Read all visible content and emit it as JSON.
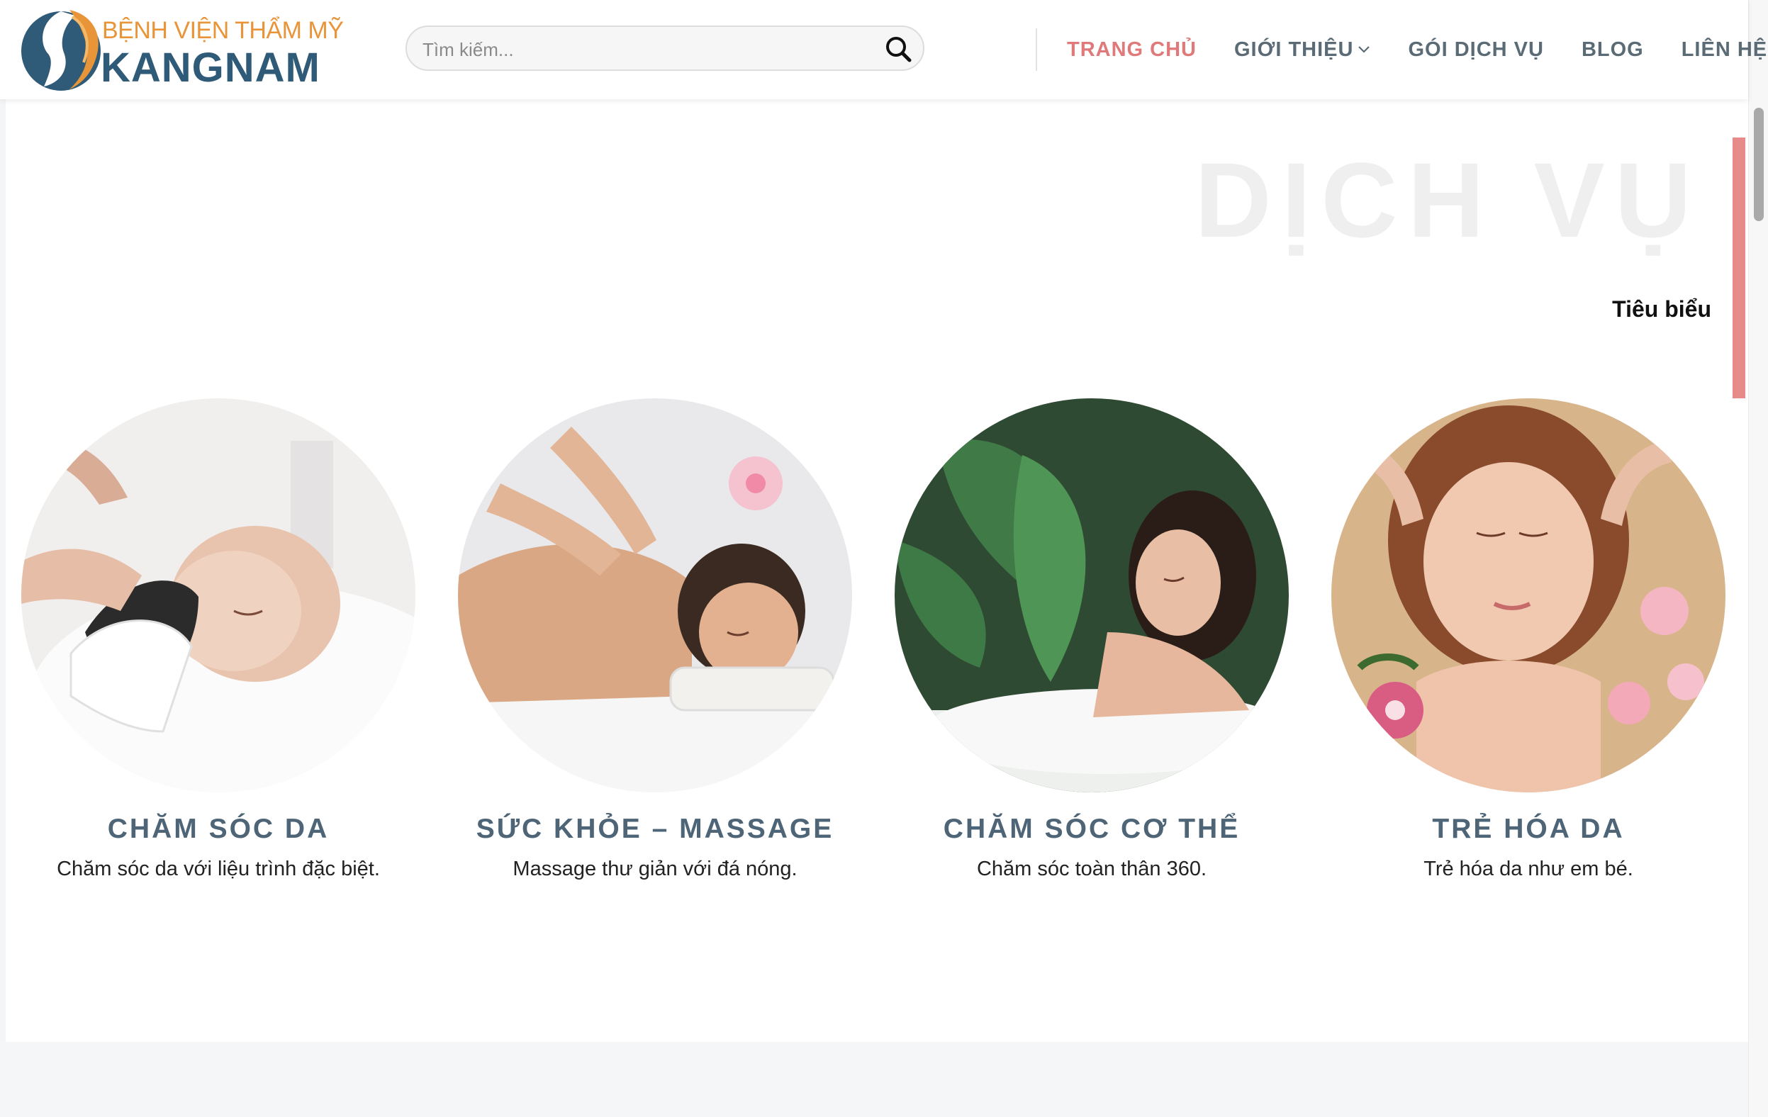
{
  "brand": {
    "line1": "BỆNH VIỆN THẨM MỸ",
    "line2": "KANGNAM",
    "colors": {
      "orange": "#e8953a",
      "navy": "#2f5a78"
    }
  },
  "search": {
    "placeholder": "Tìm kiếm..."
  },
  "nav": {
    "items": [
      {
        "label": "TRANG CHỦ",
        "active": true
      },
      {
        "label": "GIỚI THIỆU",
        "dropdown": true
      },
      {
        "label": "GÓI DỊCH VỤ"
      },
      {
        "label": "BLOG"
      },
      {
        "label": "LIÊN HỆ"
      }
    ],
    "active_color": "#e07a7a"
  },
  "section": {
    "title": "DỊCH VỤ",
    "subtitle": "Tiêu biểu"
  },
  "services": [
    {
      "title": "CHĂM SÓC DA",
      "desc": "Chăm sóc da với liệu trình đặc biệt."
    },
    {
      "title": "SỨC KHỎE – MASSAGE",
      "desc": "Massage thư giản với đá nóng."
    },
    {
      "title": "CHĂM SÓC CƠ THỂ",
      "desc": "Chăm sóc toàn thân 360."
    },
    {
      "title": "TRẺ HÓA DA",
      "desc": "Trẻ hóa da như em bé."
    }
  ]
}
